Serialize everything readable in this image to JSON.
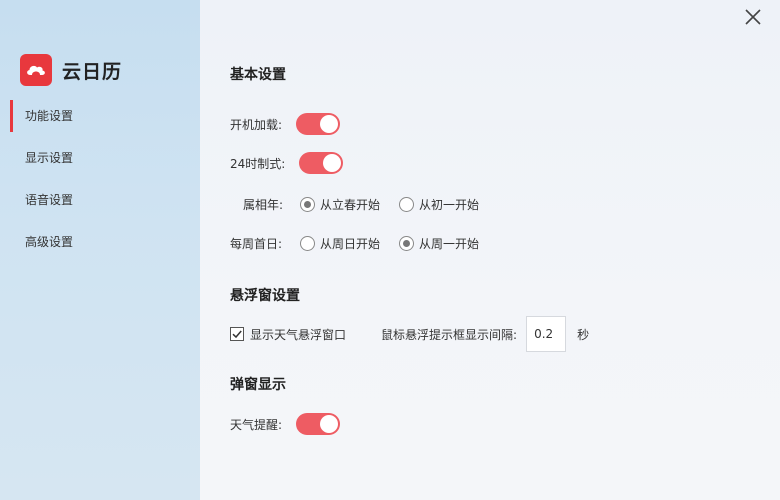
{
  "app": {
    "name": "云日历",
    "brand_color": "#e8383d",
    "toggle_color": "#ee5c63"
  },
  "sidebar": {
    "items": [
      {
        "label": "功能设置",
        "active": true
      },
      {
        "label": "显示设置",
        "active": false
      },
      {
        "label": "语音设置",
        "active": false
      },
      {
        "label": "高级设置",
        "active": false
      }
    ]
  },
  "basic": {
    "title": "基本设置",
    "startup_label": "开机加载:",
    "startup_on": true,
    "clock24_label": "24时制式:",
    "clock24_on": true,
    "zodiac_label": "属相年:",
    "zodiac_options": [
      "从立春开始",
      "从初一开始"
    ],
    "zodiac_selected": "从立春开始",
    "weekstart_label": "每周首日:",
    "weekstart_options": [
      "从周日开始",
      "从周一开始"
    ],
    "weekstart_selected": "从周一开始"
  },
  "float": {
    "title": "悬浮窗设置",
    "show_weather_label": "显示天气悬浮窗口",
    "show_weather_checked": true,
    "interval_label": "鼠标悬浮提示框显示间隔:",
    "interval_value": "0.2",
    "interval_unit": "秒"
  },
  "popup": {
    "title": "弹窗显示",
    "weather_alert_label": "天气提醒:",
    "weather_alert_on": true
  },
  "icons": {
    "logo": "cloud-logo-icon",
    "close": "close-icon",
    "check": "checkmark-icon"
  }
}
